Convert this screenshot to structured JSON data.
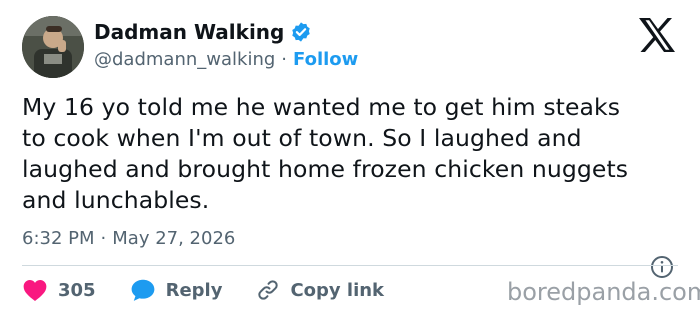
{
  "author": {
    "name": "Dadman Walking",
    "handle": "@dadmann_walking",
    "separator": "·",
    "follow_label": "Follow"
  },
  "tweet": {
    "lines": [
      "My 16 yo told me he wanted me to get him steaks",
      "to cook when I'm out of town. So I laughed and",
      "laughed and brought home frozen chicken nuggets",
      "and lunchables."
    ],
    "time": "6:32 PM",
    "separator": "·",
    "date": "May 27, 2026"
  },
  "actions": {
    "like_count": "305",
    "reply_label": "Reply",
    "copy_label": "Copy link"
  },
  "watermark": "boredpanda.com",
  "icons": {
    "verified": "verified-badge-icon",
    "x_logo": "x-logo-icon",
    "info": "info-icon",
    "heart": "heart-icon",
    "reply": "reply-bubble-icon",
    "link": "link-icon"
  },
  "colors": {
    "accent": "#1d9bf0",
    "heart": "#f91880",
    "text": "#0f1419",
    "muted": "#536471"
  }
}
